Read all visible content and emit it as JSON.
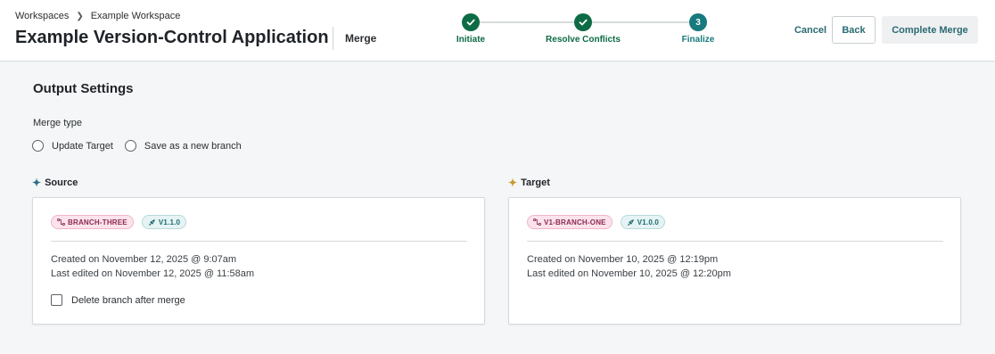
{
  "breadcrumb": {
    "items": [
      "Workspaces",
      "Example Workspace"
    ]
  },
  "header": {
    "app_title": "Example Version-Control Application",
    "mode": "Merge",
    "cancel_label": "Cancel",
    "back_label": "Back",
    "complete_label": "Complete Merge"
  },
  "stepper": {
    "steps": [
      {
        "label": "Initiate",
        "state": "done"
      },
      {
        "label": "Resolve Conflicts",
        "state": "done"
      },
      {
        "label": "Finalize",
        "state": "current",
        "number": "3"
      }
    ],
    "colors": {
      "done": "#0d6b45",
      "current": "#177a7e"
    }
  },
  "output": {
    "title": "Output Settings",
    "merge_type_label": "Merge type",
    "options": [
      "Update Target",
      "Save as a new branch"
    ]
  },
  "source": {
    "label": "Source",
    "icon": "sparkle-icon",
    "icon_color": "#2f6f86",
    "branch": "BRANCH-THREE",
    "version": "V1.1.0",
    "created": "Created on November 12, 2025 @ 9:07am",
    "edited": "Last edited on November 12, 2025 @ 11:58am",
    "delete_label": "Delete branch after merge"
  },
  "target": {
    "label": "Target",
    "icon": "sparkle-icon",
    "icon_color": "#c89a2c",
    "branch": "V1-BRANCH-ONE",
    "version": "V1.0.0",
    "created": "Created on November 10, 2025 @ 12:19pm",
    "edited": "Last edited on November 10, 2025 @ 12:20pm"
  }
}
